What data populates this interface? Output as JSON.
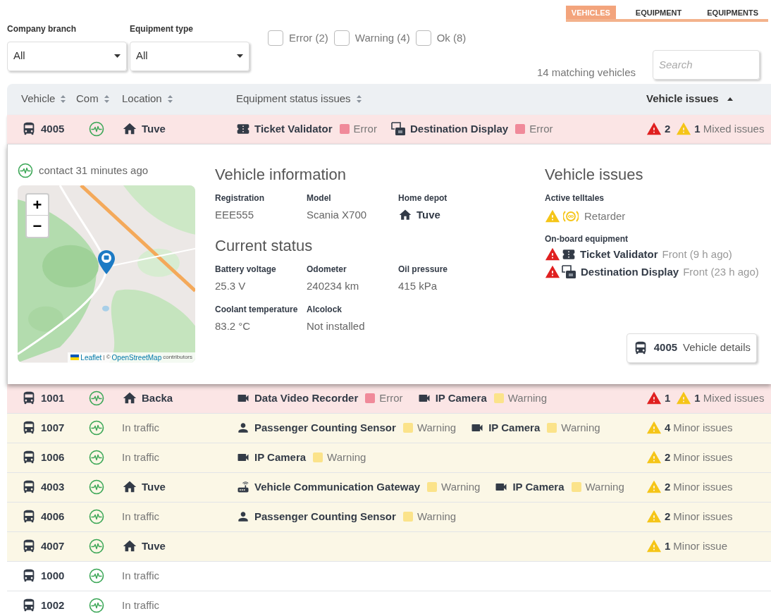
{
  "tabs": [
    {
      "label": "VEHICLES",
      "selected": true
    },
    {
      "label": "EQUIPMENT",
      "selected": false
    },
    {
      "label": "EQUIPMENTS",
      "selected": false
    }
  ],
  "filters": {
    "selects": [
      {
        "label": "Company branch",
        "value": "All"
      },
      {
        "label": "Equipment type",
        "value": "All"
      }
    ],
    "checkboxes": [
      {
        "label": "Error (2)",
        "checked": false
      },
      {
        "label": "Warning (4)",
        "checked": false
      },
      {
        "label": "Ok (8)",
        "checked": false
      }
    ],
    "count": "14 matching vehicles",
    "search": {
      "placeholder": "Search"
    }
  },
  "table": {
    "columns": [
      {
        "label": "Vehicle",
        "sorted": false
      },
      {
        "label": "Com",
        "sorted": false
      },
      {
        "label": "Location",
        "sorted": false
      },
      {
        "label": "Equipment status issues",
        "sorted": false
      },
      {
        "label": "Vehicle issues",
        "sorted": true
      }
    ],
    "rows": [
      {
        "vehicle": "4005",
        "kind": "error",
        "expanded": true,
        "location": {
          "kind": "depot",
          "name": "Tuve"
        },
        "equipment": [
          {
            "kind": "ticket",
            "name": "Ticket Validator",
            "color": "#f08a9a",
            "label": "Error"
          },
          {
            "kind": "display",
            "name": "Destination Display",
            "color": "#f08a9a",
            "label": "Error"
          }
        ],
        "issues": {
          "errors": "2",
          "warnings": "1",
          "summary": "Mixed issues"
        }
      },
      {
        "vehicle": "1001",
        "kind": "error",
        "expanded": false,
        "location": {
          "kind": "depot",
          "name": "Backa"
        },
        "equipment": [
          {
            "kind": "camera",
            "name": "Data Video Recorder",
            "color": "#f08a9a",
            "label": "Error"
          },
          {
            "kind": "camera",
            "name": "IP Camera",
            "color": "#fbe38a",
            "label": "Warning"
          }
        ],
        "issues": {
          "errors": "1",
          "warnings": "1",
          "summary": "Mixed issues"
        }
      },
      {
        "vehicle": "1007",
        "kind": "warning",
        "expanded": false,
        "location": {
          "kind": "traffic",
          "name": "In traffic"
        },
        "equipment": [
          {
            "kind": "person",
            "name": "Passenger Counting Sensor",
            "color": "#fbe38a",
            "label": "Warning"
          },
          {
            "kind": "camera",
            "name": "IP Camera",
            "color": "#fbe38a",
            "label": "Warning"
          }
        ],
        "issues": {
          "warnings": "4",
          "summary": "Minor issues"
        }
      },
      {
        "vehicle": "1006",
        "kind": "warning",
        "expanded": false,
        "location": {
          "kind": "traffic",
          "name": "In traffic"
        },
        "equipment": [
          {
            "kind": "camera",
            "name": "IP Camera",
            "color": "#fbe38a",
            "label": "Warning"
          }
        ],
        "issues": {
          "warnings": "2",
          "summary": "Minor issues"
        }
      },
      {
        "vehicle": "4003",
        "kind": "warning",
        "expanded": false,
        "location": {
          "kind": "depot",
          "name": "Tuve"
        },
        "equipment": [
          {
            "kind": "gateway",
            "name": "Vehicle Communication Gateway",
            "color": "#fbe38a",
            "label": "Warning"
          },
          {
            "kind": "camera",
            "name": "IP Camera",
            "color": "#fbe38a",
            "label": "Warning"
          }
        ],
        "issues": {
          "warnings": "2",
          "summary": "Minor issues"
        }
      },
      {
        "vehicle": "4006",
        "kind": "warning",
        "expanded": false,
        "location": {
          "kind": "traffic",
          "name": "In traffic"
        },
        "equipment": [
          {
            "kind": "person",
            "name": "Passenger Counting Sensor",
            "color": "#fbe38a",
            "label": "Warning"
          }
        ],
        "issues": {
          "warnings": "2",
          "summary": "Minor issues"
        }
      },
      {
        "vehicle": "4007",
        "kind": "warning",
        "expanded": false,
        "location": {
          "kind": "depot",
          "name": "Tuve"
        },
        "issues": {
          "warnings": "1",
          "summary": "Minor issue"
        }
      },
      {
        "vehicle": "1000",
        "kind": "ok",
        "expanded": false,
        "location": {
          "kind": "traffic",
          "name": "In traffic"
        }
      },
      {
        "vehicle": "1002",
        "kind": "ok",
        "expanded": false,
        "location": {
          "kind": "traffic",
          "name": "In traffic"
        }
      }
    ]
  },
  "details": {
    "contact": "contact 31 minutes ago",
    "map": {
      "zoom_in": "+",
      "zoom_out": "−",
      "attribution": {
        "leaflet": "Leaflet",
        "separator": "| ©",
        "osm": "OpenStreetMap",
        "suffix": "contributors"
      }
    },
    "vehicle_information": {
      "title": "Vehicle information",
      "fields": [
        {
          "label": "Registration",
          "value": "EEE555",
          "kind": "plain"
        },
        {
          "label": "Model",
          "value": "Scania X700",
          "kind": "plain"
        },
        {
          "label": "Home depot",
          "value": "Tuve",
          "kind": "depot"
        }
      ]
    },
    "current_status": {
      "title": "Current status",
      "fields": [
        {
          "label": "Battery voltage",
          "value": "25.3 V",
          "kind": "plain"
        },
        {
          "label": "Odometer",
          "value": "240234 km",
          "kind": "plain"
        },
        {
          "label": "Oil pressure",
          "value": "415 kPa",
          "kind": "plain"
        },
        {
          "label": "Coolant temperature",
          "value": "83.2 °C",
          "kind": "plain"
        },
        {
          "label": "Alcolock",
          "value": "Not installed",
          "kind": "plain"
        }
      ]
    },
    "vehicle_issues": {
      "title": "Vehicle issues",
      "telltales_title": "Active telltales",
      "telltales": [
        {
          "color": "#f5c518",
          "name": "Retarder"
        }
      ],
      "equipment_title": "On-board equipment",
      "equipment": [
        {
          "color": "#e02020",
          "kind": "ticket",
          "name": "Ticket Validator",
          "detail": "Front (9 h ago)"
        },
        {
          "color": "#e02020",
          "kind": "display",
          "name": "Destination Display",
          "detail": "Front (23 h ago)"
        }
      ]
    },
    "details_button": {
      "vehicle": "4005",
      "label": "Vehicle details"
    }
  }
}
